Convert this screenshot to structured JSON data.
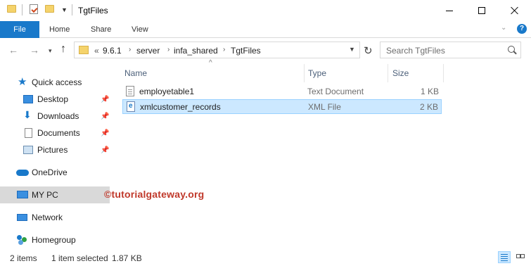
{
  "window": {
    "title": "TgtFiles",
    "quick_access_toolbar": [
      "folder-icon",
      "properties-icon",
      "new-folder-icon",
      "customize-arrow-icon"
    ]
  },
  "ribbon": {
    "tabs": [
      {
        "label": "File",
        "active": true
      },
      {
        "label": "Home"
      },
      {
        "label": "Share"
      },
      {
        "label": "View"
      }
    ],
    "accent_color": "#1979ca"
  },
  "nav": {
    "breadcrumb": [
      "«",
      "9.6.1",
      "server",
      "infa_shared",
      "TgtFiles"
    ],
    "search_placeholder": "Search TgtFiles"
  },
  "sidebar": {
    "items": [
      {
        "label": "Quick access",
        "icon": "star-icon",
        "pinned": false
      },
      {
        "label": "Desktop",
        "icon": "desktop-icon",
        "pinned": true
      },
      {
        "label": "Downloads",
        "icon": "download-icon",
        "pinned": true
      },
      {
        "label": "Documents",
        "icon": "documents-icon",
        "pinned": true
      },
      {
        "label": "Pictures",
        "icon": "pictures-icon",
        "pinned": true
      },
      {
        "label": "OneDrive",
        "icon": "cloud-icon",
        "pinned": false
      },
      {
        "label": "MY PC",
        "icon": "pc-icon",
        "pinned": false,
        "selected": true
      },
      {
        "label": "Network",
        "icon": "network-icon",
        "pinned": false
      },
      {
        "label": "Homegroup",
        "icon": "homegroup-icon",
        "pinned": false
      }
    ]
  },
  "filelist": {
    "columns": {
      "name": "Name",
      "type": "Type",
      "size": "Size"
    },
    "files": [
      {
        "name": "employetable1",
        "type": "Text Document",
        "size": "1 KB",
        "icon": "text-file-icon",
        "selected": false
      },
      {
        "name": "xmlcustomer_records",
        "type": "XML File",
        "size": "2 KB",
        "icon": "xml-file-icon",
        "selected": true
      }
    ]
  },
  "watermark": "©tutorialgateway.org",
  "status": {
    "item_count": "2 items",
    "selection": "1 item selected",
    "selection_size": "1.87 KB"
  }
}
